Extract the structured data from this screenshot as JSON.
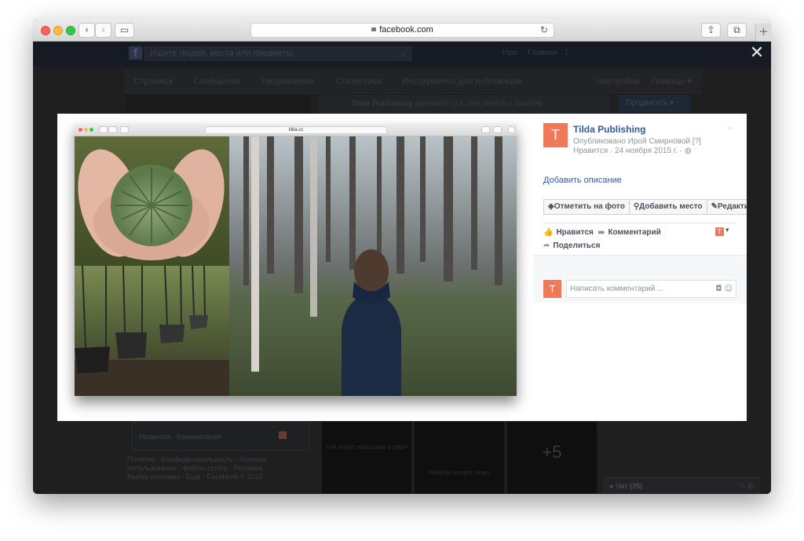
{
  "browser": {
    "address": "facebook.com",
    "back_glyph": "‹",
    "forward_glyph": "›",
    "sidebar_glyph": "▭",
    "reload_glyph": "↻",
    "share_glyph": "⇪",
    "tabs_glyph": "⧉",
    "newtab_glyph": "+"
  },
  "fb_header": {
    "logo": "f",
    "search_placeholder": "Ищите людей, места или предметы",
    "search_icon": "⌕",
    "user_name": "Ира",
    "home_label": "Главная",
    "home_count": "1",
    "close_glyph": "✕"
  },
  "page_nav": {
    "items": [
      "Страница",
      "Сообщения",
      "Уведомления",
      "Статистика",
      "Инструменты для публикации"
    ],
    "settings": "Настройки",
    "help": "Помощь ▾"
  },
  "background_post": {
    "author": "Tilda Publishing",
    "text": "добавил(-а) 6 new photos в альбом",
    "promote_label": "Продвигать ▾"
  },
  "mini_browser": {
    "address": "tilda.cc"
  },
  "side_panel": {
    "avatar_glyph": "T",
    "page_name": "Tilda Publishing",
    "published_by": "Опубликовано Ирой Смирновой [?]",
    "meta": "Нравится · 24 ноября 2015 г. · ",
    "globe_icon": "◍",
    "chevron": "⌵",
    "add_description": "Добавить описание",
    "actions": [
      {
        "icon": "◈",
        "label": "Отметить на фото"
      },
      {
        "icon": "⚲",
        "label": "Добавить место"
      },
      {
        "icon": "✎",
        "label": "Редактировать"
      }
    ],
    "like_icon": "👍",
    "like_label": "Нравится",
    "comment_icon": "▬",
    "comment_label": "Комментарий",
    "share_icon": "➦",
    "share_label": "Поделиться",
    "small_avatar_glyph": "T",
    "dropdown_glyph": "▾",
    "comment_placeholder": "Написать комментарий ...",
    "camera_icon": "◘",
    "smile_icon": "☺"
  },
  "below": {
    "like_comment": "Нравится · Комментарий",
    "footer_links": "Понятия · Конфиденциальность · Условия использования · Файлы cookie · Реклама · Выбор рекламы · Ещё · Facebook © 2015",
    "thumb1_text": "THE NIGHT WAS DARK & DEEP",
    "thumb2_text": "Wladislav Kruglov, singer",
    "thumb3_text": "+5",
    "chat_label": "● Чат (35)",
    "chat_icons": "✎ ⚙"
  },
  "colors": {
    "accent_link": "#365899",
    "avatar_orange": "#f0795a",
    "overlay_dark": "#1f1f20"
  }
}
